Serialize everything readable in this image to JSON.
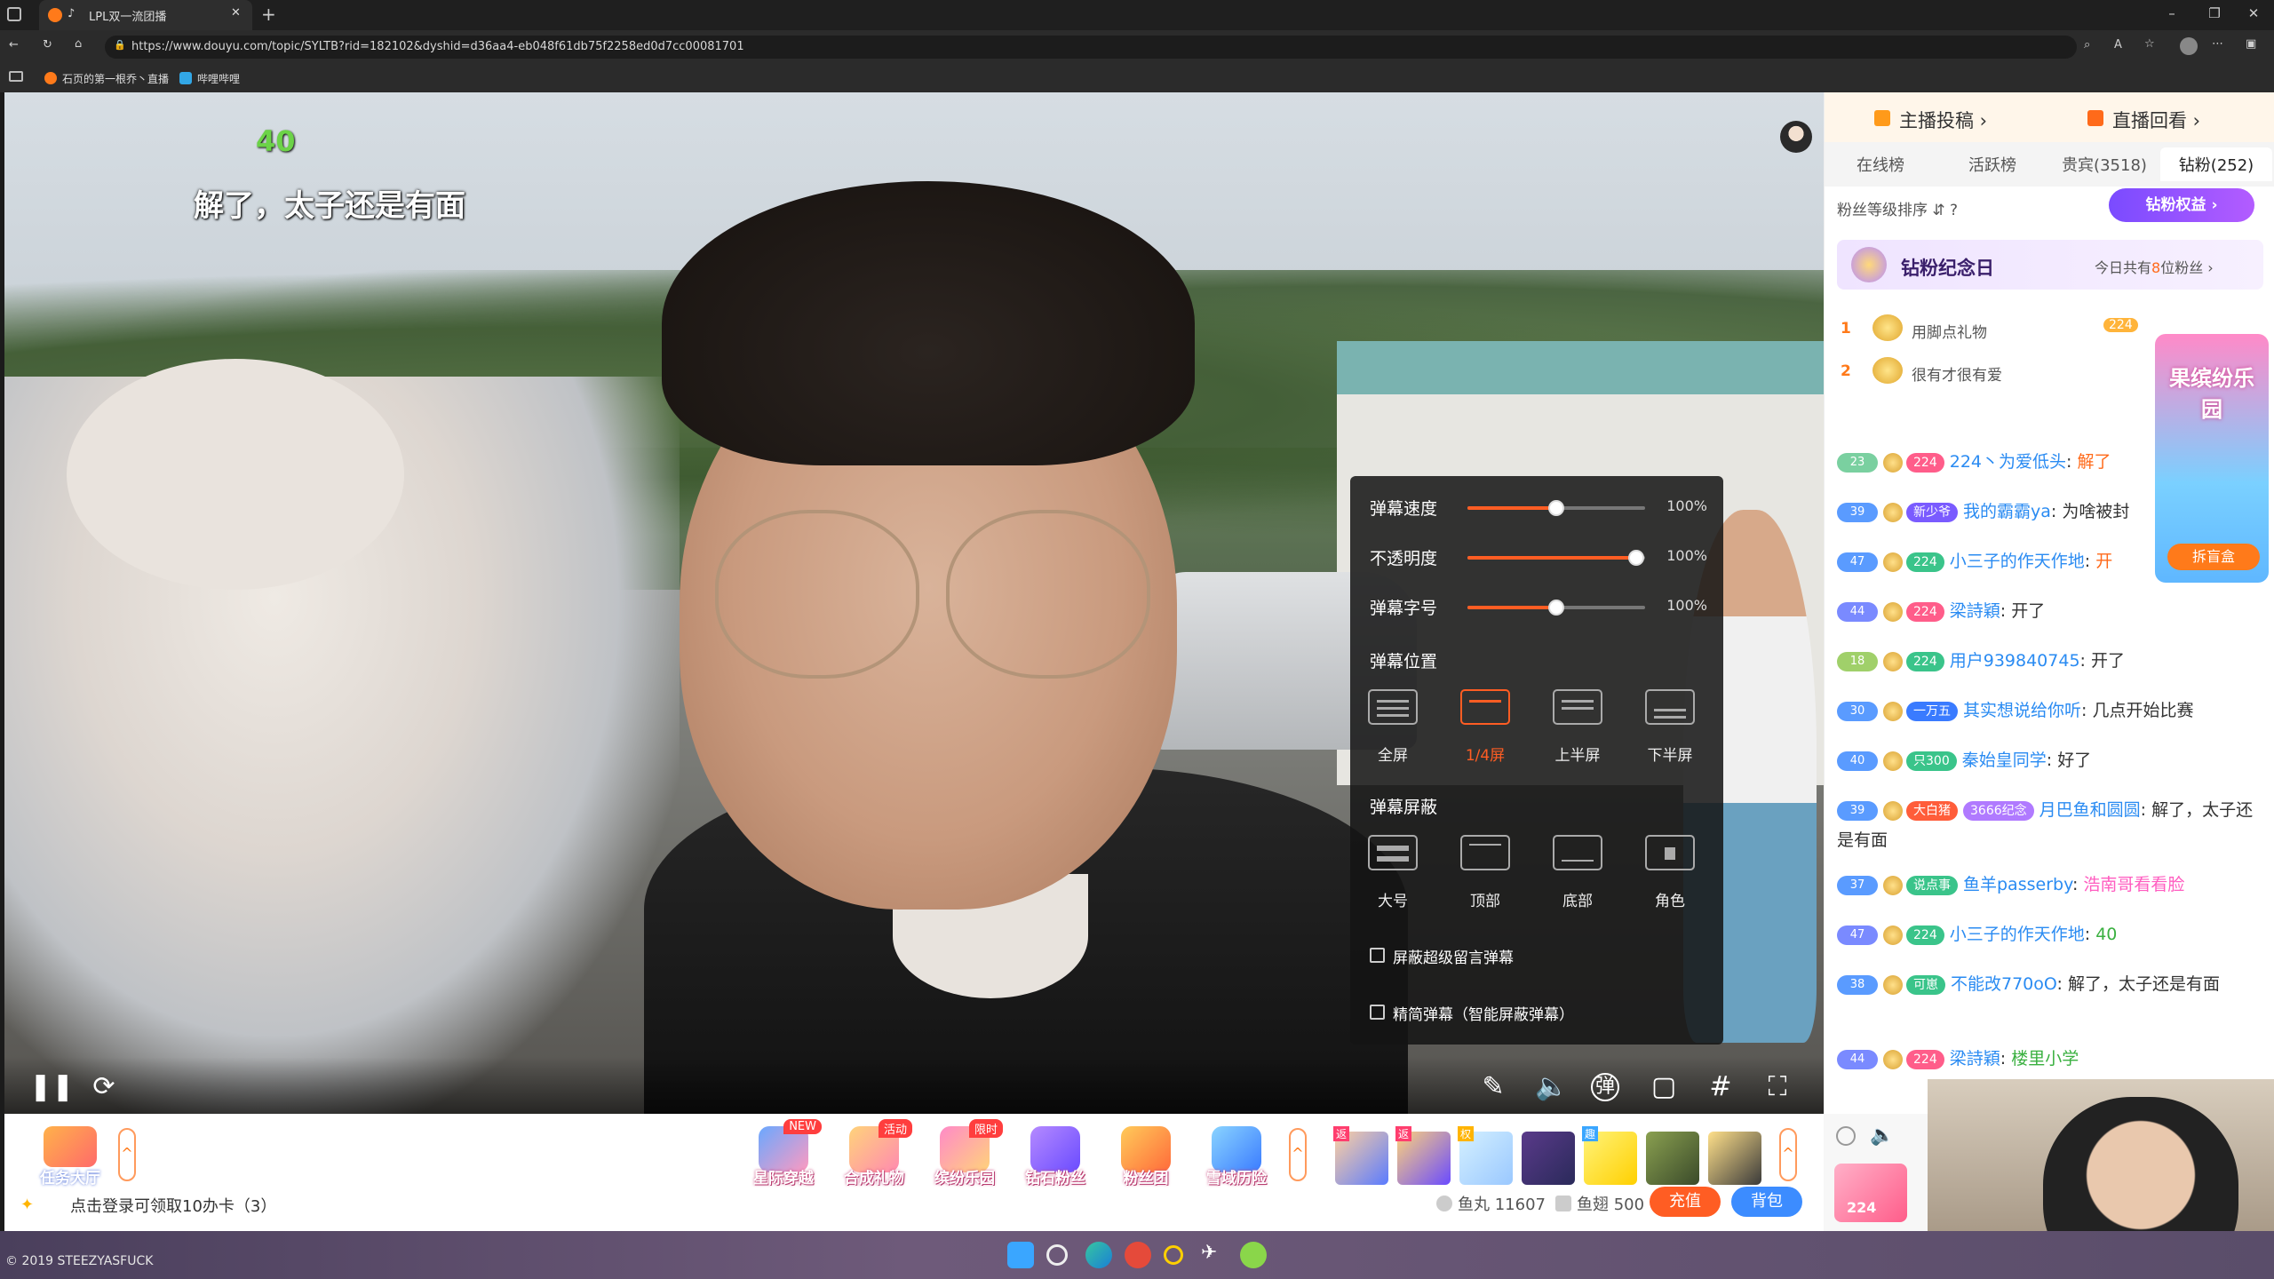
{
  "browser": {
    "tab_title": "LPL双一流团播",
    "new_tab": "+",
    "url": "https://www.douyu.com/topic/SYLTB?rid=182102&dyshid=d36aa4-eb048f61db75f2258ed0d7cc00081701",
    "favorites": [
      "石页的第一根乔丶直播",
      "哔哩哔哩"
    ],
    "window_controls": [
      "–",
      "❐",
      "✕"
    ]
  },
  "video": {
    "counter": "40",
    "danmaku_line": "解了，太子还是有面"
  },
  "danmaku_panel": {
    "sliders": [
      {
        "label": "弹幕速度",
        "value": "100%",
        "level": 0.5
      },
      {
        "label": "不透明度",
        "value": "100%",
        "level": 0.95
      },
      {
        "label": "弹幕字号",
        "value": "100%",
        "level": 0.5
      }
    ],
    "position_title": "弹幕位置",
    "position_options": [
      "全屏",
      "1/4屏",
      "上半屏",
      "下半屏"
    ],
    "position_selected": "1/4屏",
    "block_title": "弹幕屏蔽",
    "block_options": [
      "大号",
      "顶部",
      "底部",
      "角色"
    ],
    "checkboxes": [
      "屏蔽超级留言弹幕",
      "精简弹幕（智能屏蔽弹幕）"
    ]
  },
  "gift_bar": {
    "task_hall": "任务大厅",
    "gifts": [
      {
        "label": "星际穿越",
        "tag": "NEW"
      },
      {
        "label": "合成礼物",
        "tag": "活动"
      },
      {
        "label": "缤纷乐园",
        "tag": "限时"
      },
      {
        "label": "钻石粉丝",
        "tag": ""
      },
      {
        "label": "粉丝团",
        "tag": ""
      },
      {
        "label": "雪域历险",
        "tag": ""
      }
    ],
    "small_tags": [
      "返",
      "返",
      "权",
      "趣"
    ],
    "login_tip": "点击登录可领取10办卡（3）",
    "fish_balls": "鱼丸 11607",
    "fish_wings": "鱼翅 500",
    "recharge": "充值",
    "bag": "背包"
  },
  "right_panel": {
    "top_links": [
      "主播投稿 ›",
      "直播回看 ›"
    ],
    "tabs": [
      "在线榜",
      "活跃榜",
      "贵宾(3518)",
      "钻粉(252)"
    ],
    "active_tab": "钻粉(252)",
    "fan_rank_label": "粉丝等级排序 ⇵  ?",
    "diamond_button": "钻粉权益 ›",
    "memorial_title": "钻粉纪念日",
    "memorial_text_prefix": "今日共有",
    "memorial_count": "8",
    "memorial_text_suffix": "位粉丝 ›",
    "ranks": [
      {
        "n": "1",
        "name": "用脚点礼物",
        "badge": "224"
      },
      {
        "n": "2",
        "name": "很有才很有爱",
        "badge": ""
      }
    ],
    "promo": {
      "title": "果缤纷乐园",
      "button": "拆盲盒"
    },
    "chat": [
      {
        "lv": "23",
        "fan": "224",
        "user": "224丶为爱低头",
        "text": "解了",
        "lines": 1
      },
      {
        "lv": "39",
        "fan": "新少爷",
        "user": "我的霸霸ya",
        "text": "为啥被封",
        "lines": 1
      },
      {
        "lv": "47",
        "fan": "224",
        "user": "小三子的作天作地",
        "text": "开",
        "lines": 1
      },
      {
        "lv": "44",
        "fan": "224",
        "user": "梁詩穎",
        "text": "开了",
        "lines": 1
      },
      {
        "lv": "18",
        "fan": "224",
        "user": "用户939840745",
        "text": "开了",
        "lines": 1
      },
      {
        "lv": "30",
        "fan": "一万五",
        "user": "其实想说给你听",
        "text": "几点开始比赛",
        "lines": 1
      },
      {
        "lv": "40",
        "fan": "只300",
        "user": "秦始皇同学",
        "text": "好了",
        "lines": 1
      },
      {
        "lv": "39",
        "fan": "大白猪",
        "user": "月巴鱼和圆圆",
        "text": "解了，太子还是有面",
        "extra": "3666纪念",
        "lines": 2
      },
      {
        "lv": "37",
        "fan": "说点事",
        "user": "鱼羊passerby",
        "text": "浩南哥看看脸",
        "lines": 1
      },
      {
        "lv": "47",
        "fan": "224",
        "user": "小三子的作天作地",
        "text": "40",
        "lines": 1
      },
      {
        "lv": "38",
        "fan": "可崽",
        "user": "不能改770oO",
        "text": "解了，太子还是有面",
        "lines": 2
      },
      {
        "lv": "44",
        "fan": "224",
        "user": "梁詩穎",
        "text": "楼里小学",
        "lines": 1
      }
    ],
    "chat_bottom_badge": "224"
  },
  "taskbar": {
    "watermark": "© 2019 STEEZYASFUCK"
  }
}
